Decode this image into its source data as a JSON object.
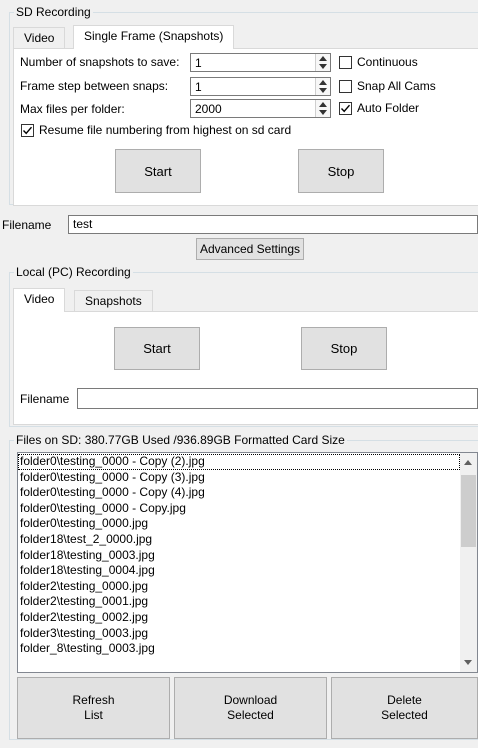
{
  "sd_recording": {
    "group_title": "SD Recording",
    "tabs": [
      {
        "label": "Video",
        "active": false
      },
      {
        "label": "Single Frame (Snapshots)",
        "active": true
      }
    ],
    "fields": {
      "num_snapshots_label": "Number of snapshots to save:",
      "num_snapshots_value": "1",
      "frame_step_label": "Frame step between snaps:",
      "frame_step_value": "1",
      "max_files_label": "Max files per folder:",
      "max_files_value": "2000"
    },
    "checkboxes": {
      "continuous": {
        "label": "Continuous",
        "checked": false
      },
      "snap_all_cams": {
        "label": "Snap All Cams",
        "checked": false
      },
      "auto_folder": {
        "label": "Auto Folder",
        "checked": true
      },
      "resume_numbering": {
        "label": "Resume file numbering from highest on sd card",
        "checked": true
      }
    },
    "start_label": "Start",
    "stop_label": "Stop",
    "filename_label": "Filename",
    "filename_value": "test",
    "advanced_label": "Advanced Settings"
  },
  "local_recording": {
    "group_title": "Local (PC) Recording",
    "tabs": [
      {
        "label": "Video",
        "active": true
      },
      {
        "label": "Snapshots",
        "active": false
      }
    ],
    "start_label": "Start",
    "stop_label": "Stop",
    "filename_label": "Filename",
    "filename_value": ""
  },
  "files_on_sd": {
    "group_title": "Files on SD: 380.77GB Used /936.89GB Formatted Card Size",
    "files": [
      "folder0\\testing_0000 - Copy (2).jpg",
      "folder0\\testing_0000 - Copy (3).jpg",
      "folder0\\testing_0000 - Copy (4).jpg",
      "folder0\\testing_0000 - Copy.jpg",
      "folder0\\testing_0000.jpg",
      "folder18\\test_2_0000.jpg",
      "folder18\\testing_0003.jpg",
      "folder18\\testing_0004.jpg",
      "folder2\\testing_0000.jpg",
      "folder2\\testing_0001.jpg",
      "folder2\\testing_0002.jpg",
      "folder3\\testing_0003.jpg",
      "folder_8\\testing_0003.jpg"
    ],
    "refresh_label": "Refresh\nList",
    "download_label": "Download\nSelected",
    "delete_label": "Delete\nSelected"
  },
  "colors": {
    "window_bg": "#f0f0f0",
    "button_bg": "#e1e1e1",
    "button_border": "#adadad",
    "group_border": "#d5dfe5"
  }
}
